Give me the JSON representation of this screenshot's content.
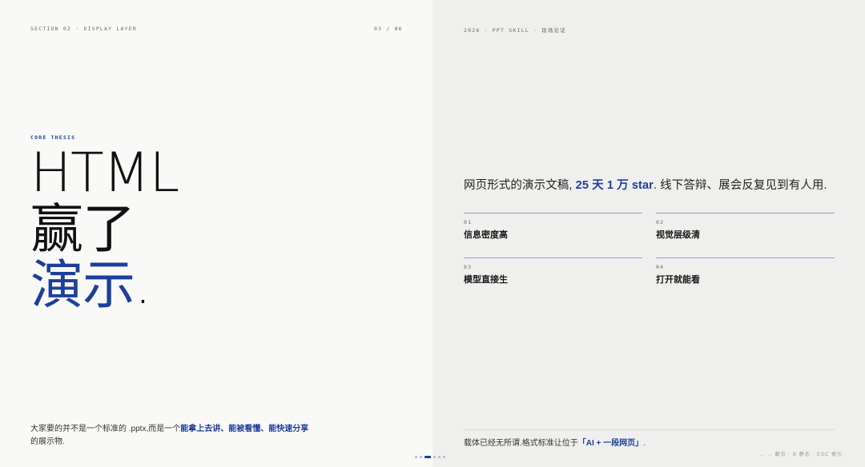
{
  "header": {
    "section": "SECTION 02 · DISPLAY LAYER",
    "page": "03 / 06",
    "right_meta": "2026 · PPT SKILL · 现场论证"
  },
  "left": {
    "kicker": "CORE THESIS",
    "headline": {
      "line1": "HTML",
      "line2": "赢了",
      "line3": "演示",
      "dot": "."
    },
    "lead": {
      "pre": "大家要的并不是一个标准的 .pptx,而是一个",
      "highlight": "能拿上去讲、能被看懂、能快速分享",
      "post": "的展示物."
    }
  },
  "right": {
    "thesis": {
      "pre": "网页形式的演示文稿, ",
      "accent": "25 天 1 万 star",
      "post": ". 线下答辩、展会反复见到有人用."
    },
    "points": [
      {
        "num": "01",
        "label": "信息密度高"
      },
      {
        "num": "02",
        "label": "视觉层级清"
      },
      {
        "num": "03",
        "label": "模型直接生"
      },
      {
        "num": "04",
        "label": "打开就能看"
      }
    ],
    "footer": {
      "pre": "载体已经无所谓.格式标准让位于",
      "accent": "「AI + 一段网页」",
      "post": "."
    }
  },
  "nav": {
    "help": "← → 翻页 · B 静态 · ESC 索引",
    "pager_total": 6,
    "pager_active": 3
  },
  "colors": {
    "accent": "#1d3f9c",
    "left_bg": "#f9f9f7",
    "right_bg": "#efefed",
    "rule": "#8aa0d8"
  }
}
